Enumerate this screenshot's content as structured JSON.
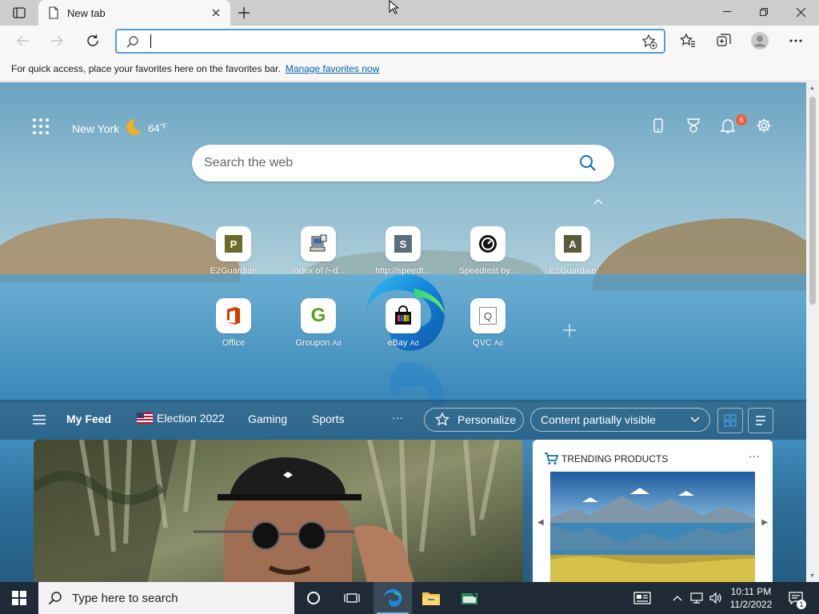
{
  "browser": {
    "tab_title": "New tab",
    "address_value": "",
    "favorites_bar_message": "For quick access, place your favorites here on the favorites bar.",
    "favorites_bar_link": "Manage favorites now"
  },
  "newtab": {
    "location": "New York",
    "temperature": "64",
    "temperature_unit": "°F",
    "notification_count": "6",
    "search_placeholder": "Search the web",
    "tiles": [
      {
        "label": "E2Guardian",
        "glyph": "P",
        "color": "#6b6b2a",
        "ad": ""
      },
      {
        "label": "Index of /~d...",
        "glyph": "",
        "color": "#ffffff",
        "ad": ""
      },
      {
        "label": "http://speedt...",
        "glyph": "S",
        "color": "#5a6e7a",
        "ad": ""
      },
      {
        "label": "Speedtest by...",
        "glyph": "",
        "color": "#111111",
        "ad": ""
      },
      {
        "label": "E2Guardian",
        "glyph": "A",
        "color": "#5b5b3b",
        "ad": ""
      },
      {
        "label": "Office",
        "glyph": "",
        "color": "#d83b01",
        "ad": ""
      },
      {
        "label": "Groupon",
        "glyph": "G",
        "color": "#53a318",
        "ad": "Ad"
      },
      {
        "label": "eBay",
        "glyph": "",
        "color": "#111111",
        "ad": "Ad"
      },
      {
        "label": "QVC",
        "glyph": "Q",
        "color": "#555555",
        "ad": "Ad"
      }
    ],
    "feed_nav": {
      "my_feed": "My Feed",
      "election": "Election 2022",
      "gaming": "Gaming",
      "sports": "Sports",
      "more": "···",
      "personalize": "Personalize",
      "content_visibility": "Content partially visible"
    },
    "trending_header": "TRENDING PRODUCTS"
  },
  "taskbar": {
    "search_placeholder": "Type here to search",
    "time": "10:11 PM",
    "date": "11/2/2022",
    "notification_count": "1"
  }
}
